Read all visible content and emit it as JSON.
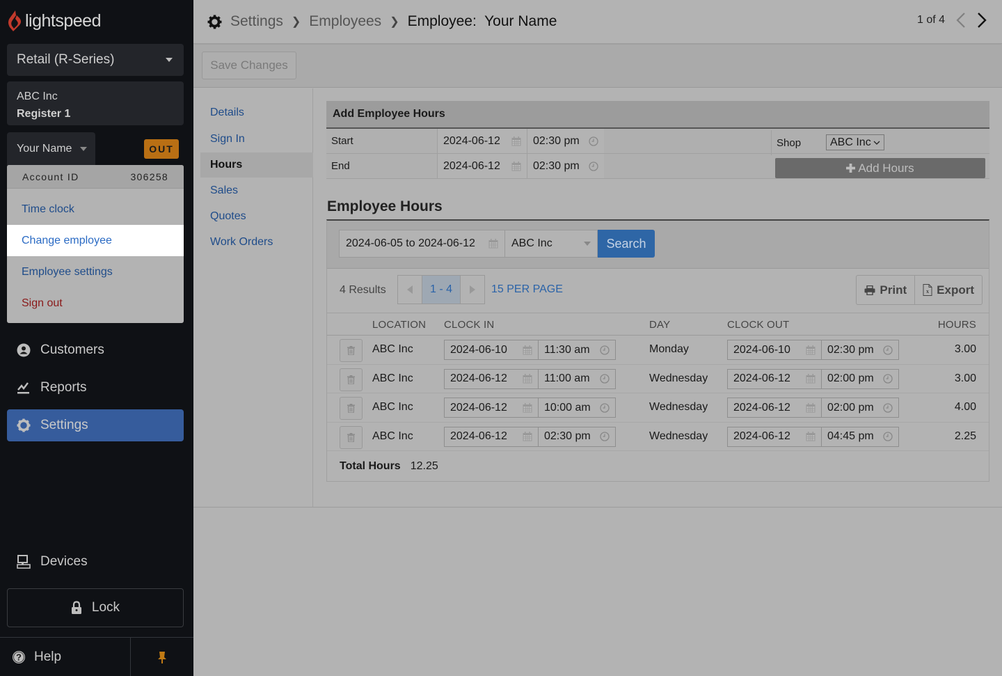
{
  "app": {
    "brand": "lightspeed"
  },
  "sidebar": {
    "product": "Retail (R-Series)",
    "store": "ABC Inc",
    "register": "Register 1",
    "user": "Your Name",
    "status_badge": "OUT",
    "dropdown": {
      "account_label": "Account ID",
      "account_id": "306258",
      "items": [
        {
          "label": "Time clock"
        },
        {
          "label": "Change employee"
        },
        {
          "label": "Employee settings"
        },
        {
          "label": "Sign out"
        }
      ]
    },
    "nav": [
      {
        "label": "Customers",
        "icon": "customer-icon"
      },
      {
        "label": "Reports",
        "icon": "reports-icon"
      },
      {
        "label": "Settings",
        "icon": "gear-icon",
        "active": true
      }
    ],
    "devices": "Devices",
    "lock": "Lock",
    "help": "Help"
  },
  "header": {
    "breadcrumb": [
      "Settings",
      "Employees",
      "Employee:  Your Name"
    ],
    "pager": "1 of 4"
  },
  "toolbar": {
    "save_label": "Save Changes"
  },
  "subnav": [
    "Details",
    "Sign In",
    "Hours",
    "Sales",
    "Quotes",
    "Work Orders"
  ],
  "add_hours": {
    "title": "Add Employee Hours",
    "start_label": "Start",
    "start_date": "2024-06-12",
    "start_time": "02:30 pm",
    "end_label": "End",
    "end_date": "2024-06-12",
    "end_time": "02:30 pm",
    "shop_label": "Shop",
    "shop_value": "ABC Inc",
    "add_button": "Add Hours"
  },
  "employee_hours": {
    "title": "Employee Hours",
    "date_range": "2024-06-05 to 2024-06-12",
    "location": "ABC Inc",
    "search_label": "Search",
    "results": "4 Results",
    "page_range": "1 - 4",
    "per_page": "15 PER PAGE",
    "print_label": "Print",
    "export_label": "Export",
    "columns": {
      "location": "LOCATION",
      "clock_in": "CLOCK IN",
      "day": "DAY",
      "clock_out": "CLOCK OUT",
      "hours": "HOURS"
    },
    "rows": [
      {
        "location": "ABC Inc",
        "in_date": "2024-06-10",
        "in_time": "11:30 am",
        "day": "Monday",
        "out_date": "2024-06-10",
        "out_time": "02:30 pm",
        "hours": "3.00"
      },
      {
        "location": "ABC Inc",
        "in_date": "2024-06-12",
        "in_time": "11:00 am",
        "day": "Wednesday",
        "out_date": "2024-06-12",
        "out_time": "02:00 pm",
        "hours": "3.00"
      },
      {
        "location": "ABC Inc",
        "in_date": "2024-06-12",
        "in_time": "10:00 am",
        "day": "Wednesday",
        "out_date": "2024-06-12",
        "out_time": "02:00 pm",
        "hours": "4.00"
      },
      {
        "location": "ABC Inc",
        "in_date": "2024-06-12",
        "in_time": "02:30 pm",
        "day": "Wednesday",
        "out_date": "2024-06-12",
        "out_time": "04:45 pm",
        "hours": "2.25"
      }
    ],
    "total_label": "Total Hours",
    "total_value": "12.25"
  }
}
